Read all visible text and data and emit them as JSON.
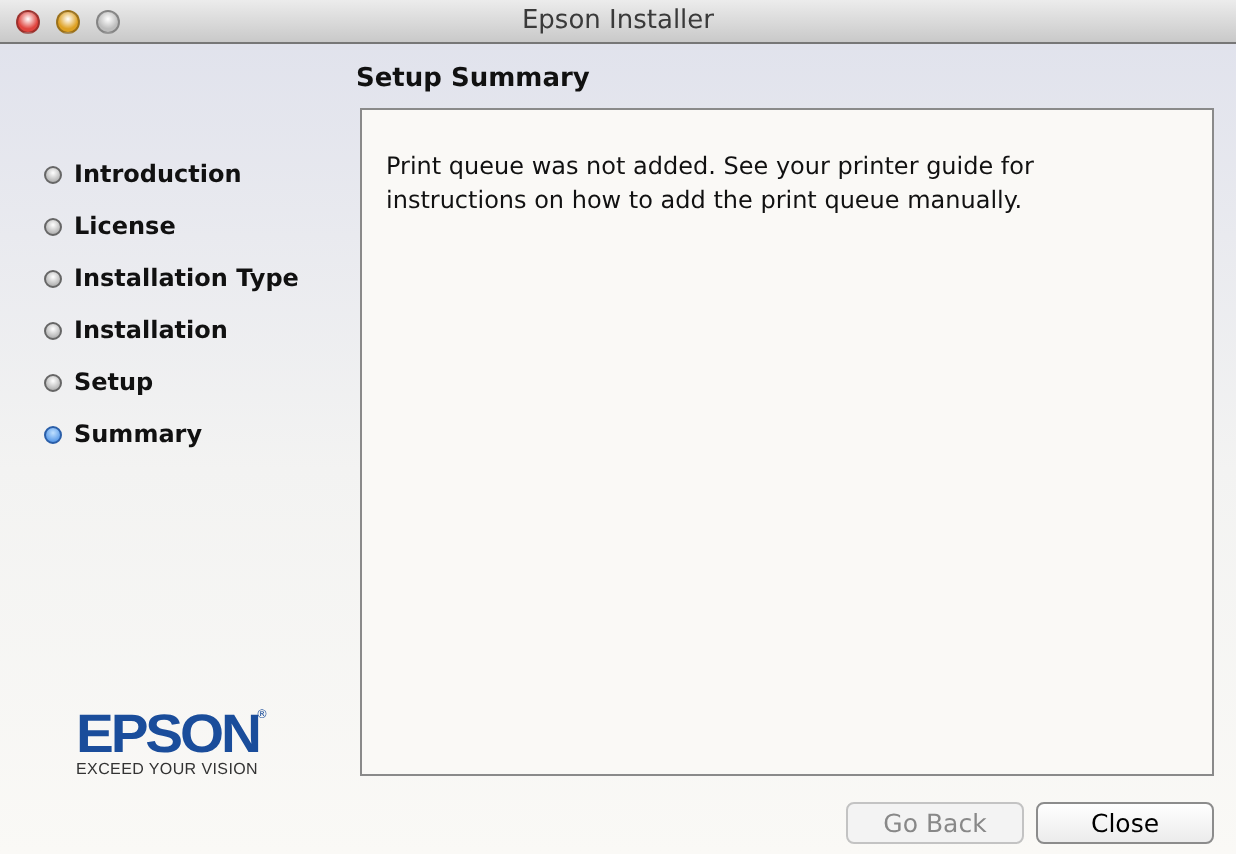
{
  "window": {
    "title": "Epson Installer"
  },
  "heading": "Setup Summary",
  "steps": [
    {
      "label": "Introduction",
      "selected": false
    },
    {
      "label": "License",
      "selected": false
    },
    {
      "label": "Installation Type",
      "selected": false
    },
    {
      "label": "Installation",
      "selected": false
    },
    {
      "label": "Setup",
      "selected": false
    },
    {
      "label": "Summary",
      "selected": true
    }
  ],
  "logo": {
    "brand": "EPSON",
    "mark": "®",
    "tagline": "EXCEED YOUR VISION"
  },
  "message": "Print queue was not added. See your printer guide for instructions on how to add the print queue manually.",
  "buttons": [
    {
      "label": "Go Back",
      "disabled": true
    },
    {
      "label": "Close",
      "disabled": false
    }
  ]
}
